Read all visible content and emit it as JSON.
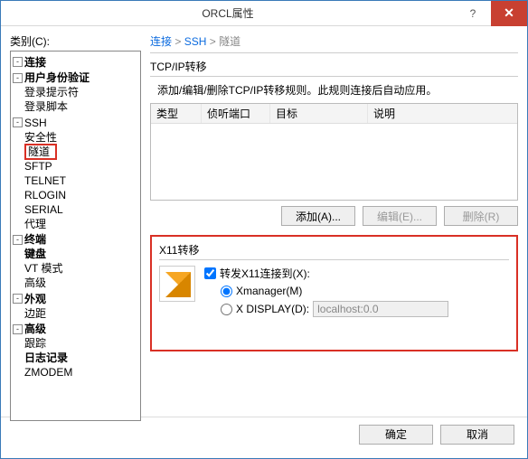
{
  "title": "ORCL属性",
  "left_label": "类别(C):",
  "tree": {
    "conn": "连接",
    "auth": "用户身份验证",
    "prompt": "登录提示符",
    "script": "登录脚本",
    "ssh": "SSH",
    "security": "安全性",
    "tunnel": "隧道",
    "sftp": "SFTP",
    "telnet": "TELNET",
    "rlogin": "RLOGIN",
    "serial": "SERIAL",
    "proxy": "代理",
    "terminal": "终端",
    "keyboard": "键盘",
    "vt": "VT 模式",
    "advanced_t": "高级",
    "appearance": "外观",
    "margins": "边距",
    "advanced": "高级",
    "trace": "跟踪",
    "log": "日志记录",
    "zmodem": "ZMODEM"
  },
  "breadcrumb": {
    "a": "连接",
    "b": "SSH",
    "c": "隧道"
  },
  "tcp": {
    "label": "TCP/IP转移",
    "desc": "添加/编辑/删除TCP/IP转移规则。此规则连接后自动应用。",
    "cols": {
      "type": "类型",
      "port": "侦听端口",
      "target": "目标",
      "desc": "说明"
    },
    "add": "添加(A)...",
    "edit": "编辑(E)...",
    "del": "删除(R)"
  },
  "x11": {
    "label": "X11转移",
    "forward": "转发X11连接到(X):",
    "xmanager": "Xmanager(M)",
    "xdisplay": "X DISPLAY(D):",
    "xdisplay_val": "localhost:0.0"
  },
  "footer": {
    "ok": "确定",
    "cancel": "取消"
  }
}
